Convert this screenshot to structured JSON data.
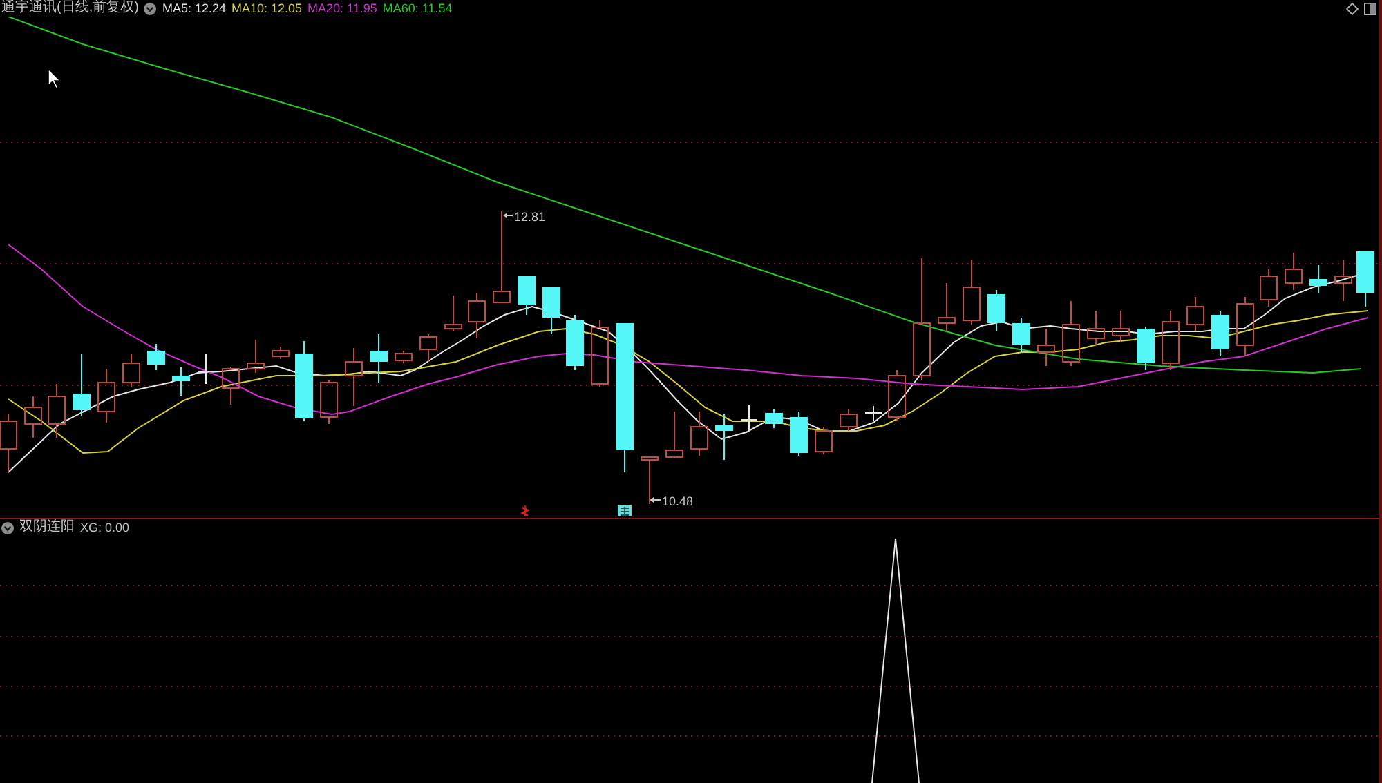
{
  "header": {
    "title": "通宇通讯(日线,前复权)",
    "moving_averages": [
      {
        "label": "MA5: 12.24",
        "color": "#e6e6e6"
      },
      {
        "label": "MA10: 12.05",
        "color": "#d8d23c"
      },
      {
        "label": "MA20: 11.95",
        "color": "#d22ed2"
      },
      {
        "label": "MA60: 11.54",
        "color": "#28c828"
      }
    ]
  },
  "price_chart": {
    "high_label": "12.81",
    "low_label": "10.48"
  },
  "indicator_panel": {
    "title": "双阴连阳",
    "value": "XG: 0.00"
  }
}
